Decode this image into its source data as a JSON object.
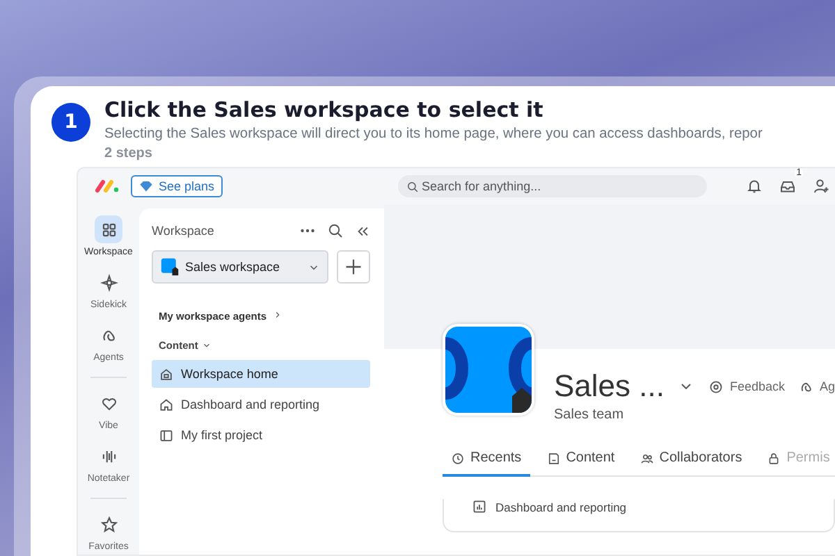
{
  "step": {
    "number": "1",
    "title": "Click the Sales workspace to select it",
    "description": "Selecting the Sales workspace will direct you to its home page, where you can access dashboards, repor",
    "count": "2 steps"
  },
  "topbar": {
    "plans_button": "See plans",
    "search": {
      "placeholder": "Search for anything..."
    },
    "inbox_badge": "1"
  },
  "rail": [
    [
      {
        "label": "Workspace",
        "selected": true
      },
      {
        "label": "Sidekick",
        "selected": false
      },
      {
        "label": "Agents",
        "selected": false
      }
    ],
    [
      {
        "label": "Vibe",
        "selected": false
      },
      {
        "label": "Notetaker",
        "selected": false
      }
    ],
    [
      {
        "label": "Favorites",
        "selected": false
      }
    ]
  ],
  "workspace_panel": {
    "title": "Workspace",
    "workspace_select": "Sales workspace",
    "agents_link": "My workspace agents",
    "section": "Content",
    "items": [
      {
        "label": "Workspace home",
        "selected": true
      },
      {
        "label": "Dashboard and reporting",
        "selected": false
      },
      {
        "label": "My first project",
        "selected": false
      }
    ]
  },
  "main": {
    "title": "Sales ...",
    "subtitle": "Sales team",
    "actions": [
      "Feedback",
      "Ag"
    ],
    "tabs": [
      {
        "label": "Recents",
        "selected": true,
        "disabled": false
      },
      {
        "label": "Content",
        "selected": false,
        "disabled": false
      },
      {
        "label": "Collaborators",
        "selected": false,
        "disabled": false
      },
      {
        "label": "Permis",
        "selected": false,
        "disabled": true
      }
    ],
    "recents": [
      "Dashboard and reporting"
    ]
  }
}
